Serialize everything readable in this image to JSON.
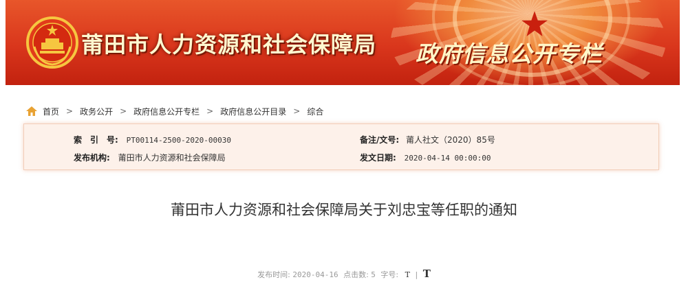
{
  "banner": {
    "site_title": "莆田市人力资源和社会保障局",
    "column_title": "政府信息公开专栏"
  },
  "breadcrumb": [
    "首页",
    "政务公开",
    "政府信息公开专栏",
    "政府信息公开目录",
    "综合"
  ],
  "meta": {
    "index_label": "索　引　号:",
    "index_value": "PT00114-2500-2020-00030",
    "doc_label": "备注/文号:",
    "doc_value": "莆人社文（2020）85号",
    "org_label": "发布机构:",
    "org_value": "莆田市人力资源和社会保障局",
    "date_label": "发文日期:",
    "date_value": "2020-04-14 00:00:00"
  },
  "article": {
    "title": "莆田市人力资源和社会保障局关于刘忠宝等任职的通知",
    "pub_time_label": "发布时间:",
    "pub_time_value": "2020-04-16",
    "clicks_label": "点击数:",
    "clicks_value": "5",
    "font_label": "字号:",
    "font_small": "T",
    "font_large": "T"
  },
  "colors": {
    "banner_red": "#d9361c",
    "title_gold": "#fff8d0",
    "meta_bg": "#fdf1ea"
  }
}
